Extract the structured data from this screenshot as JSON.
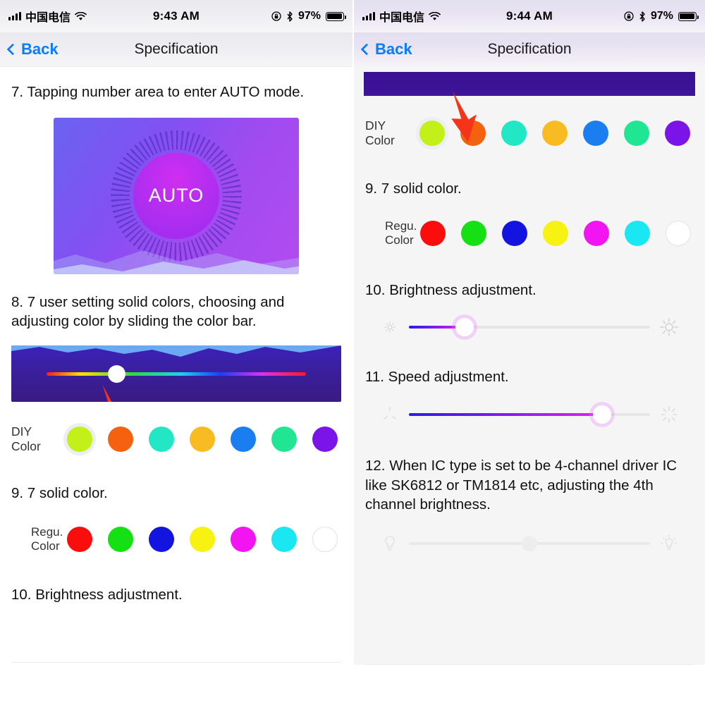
{
  "left": {
    "status": {
      "carrier": "中国电信",
      "time": "9:43 AM",
      "battery_pct": "97%",
      "wifi_icon": "wifi-icon",
      "signal_icon": "signal-bars-icon",
      "rotation_lock_icon": "rotation-lock-icon",
      "bluetooth_icon": "bluetooth-icon",
      "battery_icon": "battery-icon"
    },
    "nav": {
      "back_label": "Back",
      "title": "Specification",
      "back_icon": "chevron-left-icon"
    },
    "step7": "7. Tapping number area to enter AUTO mode.",
    "auto_illustration": {
      "label": "AUTO",
      "name": "auto-mode-illustration"
    },
    "step8": "8. 7 user setting solid colors, choosing and adjusting color by sliding the color bar.",
    "color_bar": {
      "name": "color-bar-illustration",
      "handle_percent": 27
    },
    "diy": {
      "label": "DIY Color",
      "selected_index": 0,
      "colors": [
        "#c2f018",
        "#f4610f",
        "#21e7c4",
        "#f9bb22",
        "#1b7ef0",
        "#20e694",
        "#7a14e8"
      ]
    },
    "step9": "9. 7 solid color.",
    "regu": {
      "label": "Regu. Color",
      "colors": [
        "#fb0d0d",
        "#14e014",
        "#1414e0",
        "#f7f211",
        "#f215f2",
        "#1ae7f2",
        "#ffffff"
      ]
    },
    "step10": "10. Brightness adjustment."
  },
  "right": {
    "status": {
      "carrier": "中国电信",
      "time": "9:44 AM",
      "battery_pct": "97%",
      "wifi_icon": "wifi-icon",
      "signal_icon": "signal-bars-icon",
      "rotation_lock_icon": "rotation-lock-icon",
      "bluetooth_icon": "bluetooth-icon",
      "battery_icon": "battery-icon"
    },
    "nav": {
      "back_label": "Back",
      "title": "Specification",
      "back_icon": "chevron-left-icon"
    },
    "diy": {
      "label": "DIY Color",
      "selected_index": 0,
      "colors": [
        "#c2f018",
        "#f4610f",
        "#21e7c4",
        "#f9bb22",
        "#1b7ef0",
        "#20e694",
        "#7a14e8"
      ]
    },
    "step9": "9. 7 solid color.",
    "regu": {
      "label": "Regu. Color",
      "colors": [
        "#fb0d0d",
        "#14e014",
        "#1414e0",
        "#f7f211",
        "#f215f2",
        "#1ae7f2",
        "#ffffff"
      ]
    },
    "step10": "10. Brightness adjustment.",
    "brightness_slider": {
      "name": "brightness-slider",
      "value_percent": 23,
      "left_icon": "sun-small-icon",
      "right_icon": "sun-large-icon"
    },
    "step11": "11. Speed adjustment.",
    "speed_slider": {
      "name": "speed-slider",
      "value_percent": 80,
      "left_icon": "speed-slow-icon",
      "right_icon": "speed-fast-icon"
    },
    "step12": "12. When IC type is set to be 4-channel driver IC like SK6812 or TM1814 etc, adjusting the 4th channel brightness.",
    "channel4_slider": {
      "name": "fourth-channel-brightness-slider",
      "value_percent": 50,
      "left_icon": "bulb-off-icon",
      "right_icon": "bulb-on-icon",
      "disabled": true
    }
  },
  "accent": {
    "ios_blue": "#0a7cff",
    "arrow_red": "#f5341a"
  }
}
